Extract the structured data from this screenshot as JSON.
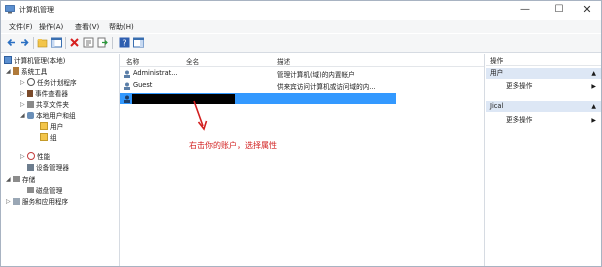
{
  "window": {
    "title": "计算机管理"
  },
  "menu": [
    "文件(F)",
    "操作(A)",
    "查看(V)",
    "帮助(H)"
  ],
  "toolbar": {
    "icons": [
      "back-arrow-icon",
      "forward-arrow-icon",
      "up-folder-icon",
      "show-tree-icon",
      "delete-icon",
      "properties-icon",
      "export-icon",
      "help-icon",
      "view-pane-icon"
    ]
  },
  "tree": {
    "root": "计算机管理(本地)",
    "system_tools": "系统工具",
    "task_scheduler": "任务计划程序",
    "event_viewer": "事件查看器",
    "shared_folders": "共享文件夹",
    "local_users_groups": "本地用户和组",
    "users": "用户",
    "groups": "组",
    "performance": "性能",
    "device_manager": "设备管理器",
    "storage": "存储",
    "disk_management": "磁盘管理",
    "services_apps": "服务和应用程序"
  },
  "list": {
    "headers": [
      "名称",
      "全名",
      "描述"
    ],
    "rows": [
      {
        "name": "Administrat...",
        "desc": "管理计算机(域)的内置帐户"
      },
      {
        "name": "Guest",
        "desc": "供来宾访问计算机或访问域的内..."
      }
    ]
  },
  "annotation": {
    "text": "右击你的账户，选择属性",
    "color": "#d21f1f"
  },
  "actions": {
    "header": "操作",
    "section1": "用户",
    "more1": "更多操作",
    "section2": "Jical",
    "more2": "更多操作"
  },
  "colors": {
    "selection": "#3399ff",
    "section_bg": "#dde7f5"
  }
}
